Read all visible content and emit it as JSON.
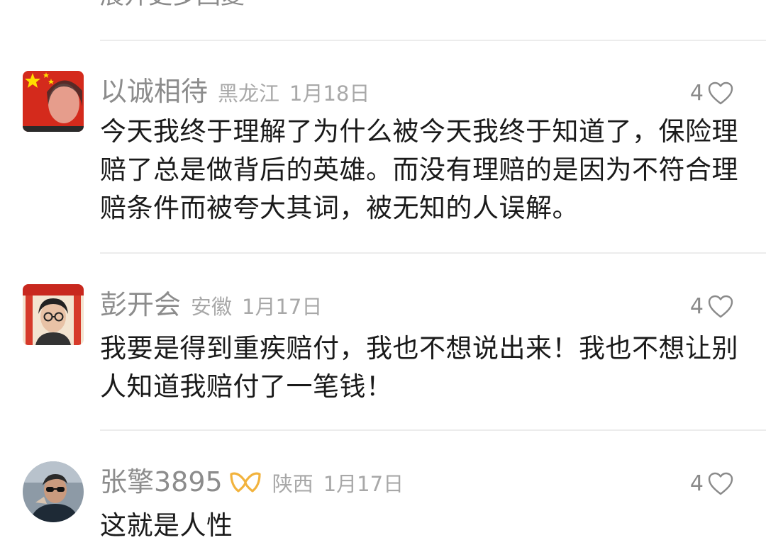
{
  "top_partial_text": "展开更多回复",
  "comments": [
    {
      "username": "以诚相待",
      "location": "黑龙江",
      "date": "1月18日",
      "likes": "4",
      "text": "今天我终于理解了为什么被今天我终于知道了，保险理赔了总是做背后的英雄。而没有理赔的是因为不符合理赔条件而被夸大其词，被无知的人误解。"
    },
    {
      "username": "彭开会",
      "location": "安徽",
      "date": "1月17日",
      "likes": "4",
      "text": "我要是得到重疾赔付，我也不想说出来！我也不想让别人知道我赔付了一笔钱！"
    },
    {
      "username": "张擎3895",
      "location": "陕西",
      "date": "1月17日",
      "likes": "4",
      "text": "这就是人性"
    }
  ],
  "colors": {
    "username": "#8c8c8c",
    "meta": "#a8a8a8",
    "text": "#1a1a1a",
    "divider": "#ececec",
    "badge": "#f2b33d"
  }
}
